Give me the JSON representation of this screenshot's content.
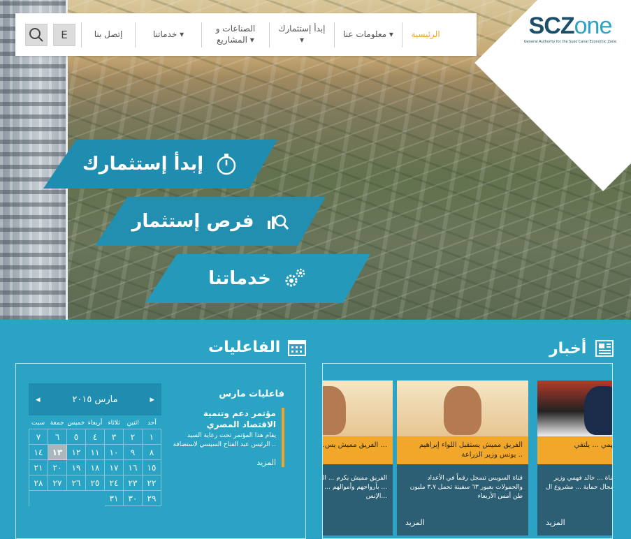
{
  "nav": {
    "lang_label": "E",
    "items": [
      {
        "label": "الرئيسية",
        "active": true
      },
      {
        "label": "معلومات عنا ▾"
      },
      {
        "label": "إبدأ إستثمارك ▾"
      },
      {
        "label": "الصناعات و المشاريع ▾"
      },
      {
        "label": "خدماتنا ▾"
      },
      {
        "label": "إتصل بنا"
      }
    ]
  },
  "logo": {
    "main": "SCZ",
    "suffix": "one",
    "subtitle": "General Authority for the Suez Canal Economic Zone"
  },
  "hero": {
    "tiles": [
      {
        "label": "إبدأ إستثمارك",
        "icon": "stopwatch-icon"
      },
      {
        "label": "فرص إستثمار",
        "icon": "search-chart-icon"
      },
      {
        "label": "خدماتنا",
        "icon": "gears-icon"
      }
    ]
  },
  "events": {
    "heading": "الفاعليات",
    "list_title": "فاعليات مارس",
    "item_title": "مؤتمر دعم وتنمية الاقتصاد المصري",
    "item_desc": "يقام هذا المؤتمر تحت رعاية السيد الرئيس عبد الفتاح السيسي لاستضافة ..",
    "more": "المزيد",
    "calendar": {
      "month": "مارس ٢٠١٥",
      "prev": "◂",
      "next": "▸",
      "days": [
        "سبت",
        "جمعة",
        "خميس",
        "أربعاء",
        "ثلاثاء",
        "اثنين",
        "أحد"
      ],
      "weeks": [
        [
          "٧",
          "٦",
          "٥",
          "٤",
          "٣",
          "٢",
          "١"
        ],
        [
          "١٤",
          "١٣",
          "١٢",
          "١١",
          "١٠",
          "٩",
          "٨"
        ],
        [
          "٢١",
          "٢٠",
          "١٩",
          "١٨",
          "١٧",
          "١٦",
          "١٥"
        ],
        [
          "٢٨",
          "٢٧",
          "٢٦",
          "٢٥",
          "٢٤",
          "٢٣",
          "٢٢"
        ],
        [
          "",
          "",
          "",
          "",
          "٣١",
          "٣٠",
          "٢٩"
        ]
      ],
      "today": "١٣"
    }
  },
  "news": {
    "heading": "أخبار",
    "cards": [
      {
        "caption": "الفريق مميش يس... الفريق عبدالعزيز ...",
        "body": "الفريق مميش يكرم ... المحجوب \" المصري ... بأرواحهم وأموالهم ... وسعادة الأسرة الإنس..."
      },
      {
        "caption": "الفريق مميش يستقبل اللواء إبراهيم يونس وزير الزراعة ..",
        "body": "قناة السويس تسجل رقماً في الأعداد والحمولات بعبور ٦٣ سفينة تحمل ٣.٧ مليون طن أمس الأربعاء",
        "more": "المزيد"
      },
      {
        "caption": "الدكتور خالد فهمي ... يلتقي ...",
        "body": "مميش رئيس هيئة قناة ... خالد فهمي وزير البيئة ... تعاون في مجال حماية ... مشروع ال ...",
        "more": "المزيد"
      }
    ]
  }
}
